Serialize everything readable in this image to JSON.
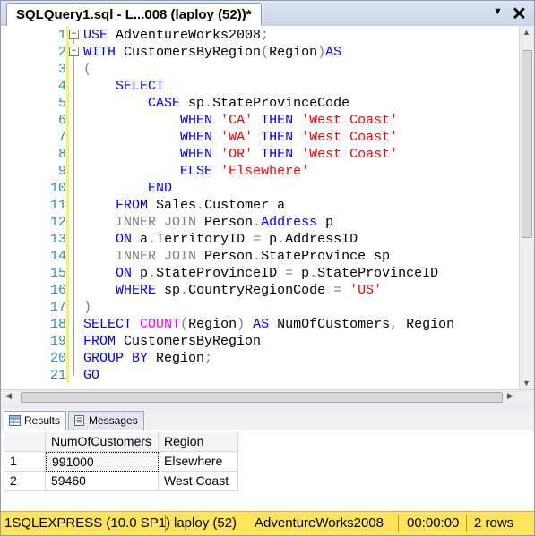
{
  "document_tab": {
    "title": "SQLQuery1.sql - L...008 (laploy (52))*",
    "dropdown_icon": "chevron-down-icon",
    "close_icon": "close-icon"
  },
  "editor": {
    "lines": [
      {
        "num": "1",
        "tokens": [
          {
            "t": "USE",
            "c": "kw"
          },
          {
            "t": " AdventureWorks2008",
            "c": "tx"
          },
          {
            "t": ";",
            "c": "gr"
          }
        ]
      },
      {
        "num": "2",
        "tokens": [
          {
            "t": "WITH",
            "c": "kw"
          },
          {
            "t": " CustomersByRegion",
            "c": "tx"
          },
          {
            "t": "(",
            "c": "gr"
          },
          {
            "t": "Region",
            "c": "tx"
          },
          {
            "t": ")",
            "c": "gr"
          },
          {
            "t": "AS",
            "c": "kw"
          }
        ]
      },
      {
        "num": "3",
        "tokens": [
          {
            "t": "(",
            "c": "gr"
          }
        ]
      },
      {
        "num": "4",
        "tokens": [
          {
            "t": "    ",
            "c": "tx"
          },
          {
            "t": "SELECT",
            "c": "kw"
          }
        ]
      },
      {
        "num": "5",
        "tokens": [
          {
            "t": "        ",
            "c": "tx"
          },
          {
            "t": "CASE",
            "c": "kw"
          },
          {
            "t": " sp",
            "c": "tx"
          },
          {
            "t": ".",
            "c": "gr"
          },
          {
            "t": "StateProvinceCode",
            "c": "tx"
          }
        ]
      },
      {
        "num": "6",
        "tokens": [
          {
            "t": "            ",
            "c": "tx"
          },
          {
            "t": "WHEN",
            "c": "kw"
          },
          {
            "t": " ",
            "c": "tx"
          },
          {
            "t": "'CA'",
            "c": "st"
          },
          {
            "t": " ",
            "c": "tx"
          },
          {
            "t": "THEN",
            "c": "kw"
          },
          {
            "t": " ",
            "c": "tx"
          },
          {
            "t": "'West Coast'",
            "c": "st"
          }
        ]
      },
      {
        "num": "7",
        "tokens": [
          {
            "t": "            ",
            "c": "tx"
          },
          {
            "t": "WHEN",
            "c": "kw"
          },
          {
            "t": " ",
            "c": "tx"
          },
          {
            "t": "'WA'",
            "c": "st"
          },
          {
            "t": " ",
            "c": "tx"
          },
          {
            "t": "THEN",
            "c": "kw"
          },
          {
            "t": " ",
            "c": "tx"
          },
          {
            "t": "'West Coast'",
            "c": "st"
          }
        ]
      },
      {
        "num": "8",
        "tokens": [
          {
            "t": "            ",
            "c": "tx"
          },
          {
            "t": "WHEN",
            "c": "kw"
          },
          {
            "t": " ",
            "c": "tx"
          },
          {
            "t": "'OR'",
            "c": "st"
          },
          {
            "t": " ",
            "c": "tx"
          },
          {
            "t": "THEN",
            "c": "kw"
          },
          {
            "t": " ",
            "c": "tx"
          },
          {
            "t": "'West Coast'",
            "c": "st"
          }
        ]
      },
      {
        "num": "9",
        "tokens": [
          {
            "t": "            ",
            "c": "tx"
          },
          {
            "t": "ELSE",
            "c": "kw"
          },
          {
            "t": " ",
            "c": "tx"
          },
          {
            "t": "'Elsewhere'",
            "c": "st"
          }
        ]
      },
      {
        "num": "10",
        "tokens": [
          {
            "t": "        ",
            "c": "tx"
          },
          {
            "t": "END",
            "c": "kw"
          }
        ]
      },
      {
        "num": "11",
        "tokens": [
          {
            "t": "    ",
            "c": "tx"
          },
          {
            "t": "FROM",
            "c": "kw"
          },
          {
            "t": " Sales",
            "c": "tx"
          },
          {
            "t": ".",
            "c": "gr"
          },
          {
            "t": "Customer a",
            "c": "tx"
          }
        ]
      },
      {
        "num": "12",
        "tokens": [
          {
            "t": "    ",
            "c": "tx"
          },
          {
            "t": "INNER JOIN",
            "c": "gr"
          },
          {
            "t": " Person",
            "c": "tx"
          },
          {
            "t": ".",
            "c": "gr"
          },
          {
            "t": "Address",
            "c": "kw"
          },
          {
            "t": " p",
            "c": "tx"
          }
        ]
      },
      {
        "num": "13",
        "tokens": [
          {
            "t": "    ",
            "c": "tx"
          },
          {
            "t": "ON",
            "c": "kw"
          },
          {
            "t": " a",
            "c": "tx"
          },
          {
            "t": ".",
            "c": "gr"
          },
          {
            "t": "TerritoryID ",
            "c": "tx"
          },
          {
            "t": "=",
            "c": "gr"
          },
          {
            "t": " p",
            "c": "tx"
          },
          {
            "t": ".",
            "c": "gr"
          },
          {
            "t": "AddressID",
            "c": "tx"
          }
        ]
      },
      {
        "num": "14",
        "tokens": [
          {
            "t": "    ",
            "c": "tx"
          },
          {
            "t": "INNER JOIN",
            "c": "gr"
          },
          {
            "t": " Person",
            "c": "tx"
          },
          {
            "t": ".",
            "c": "gr"
          },
          {
            "t": "StateProvince sp",
            "c": "tx"
          }
        ]
      },
      {
        "num": "15",
        "tokens": [
          {
            "t": "    ",
            "c": "tx"
          },
          {
            "t": "ON",
            "c": "kw"
          },
          {
            "t": " p",
            "c": "tx"
          },
          {
            "t": ".",
            "c": "gr"
          },
          {
            "t": "StateProvinceID ",
            "c": "tx"
          },
          {
            "t": "=",
            "c": "gr"
          },
          {
            "t": " p",
            "c": "tx"
          },
          {
            "t": ".",
            "c": "gr"
          },
          {
            "t": "StateProvinceID",
            "c": "tx"
          }
        ]
      },
      {
        "num": "16",
        "tokens": [
          {
            "t": "    ",
            "c": "tx"
          },
          {
            "t": "WHERE",
            "c": "kw"
          },
          {
            "t": " sp",
            "c": "tx"
          },
          {
            "t": ".",
            "c": "gr"
          },
          {
            "t": "CountryRegionCode ",
            "c": "tx"
          },
          {
            "t": "=",
            "c": "gr"
          },
          {
            "t": " ",
            "c": "tx"
          },
          {
            "t": "'US'",
            "c": "st"
          }
        ]
      },
      {
        "num": "17",
        "tokens": [
          {
            "t": ")",
            "c": "gr"
          }
        ]
      },
      {
        "num": "18",
        "tokens": [
          {
            "t": "SELECT",
            "c": "kw"
          },
          {
            "t": " ",
            "c": "tx"
          },
          {
            "t": "COUNT",
            "c": "fn"
          },
          {
            "t": "(",
            "c": "gr"
          },
          {
            "t": "Region",
            "c": "tx"
          },
          {
            "t": ")",
            "c": "gr"
          },
          {
            "t": " ",
            "c": "tx"
          },
          {
            "t": "AS",
            "c": "kw"
          },
          {
            "t": " NumOfCustomers",
            "c": "tx"
          },
          {
            "t": ",",
            "c": "gr"
          },
          {
            "t": " Region",
            "c": "tx"
          }
        ]
      },
      {
        "num": "19",
        "tokens": [
          {
            "t": "FROM",
            "c": "kw"
          },
          {
            "t": " CustomersByRegion",
            "c": "tx"
          }
        ]
      },
      {
        "num": "20",
        "tokens": [
          {
            "t": "GROUP BY",
            "c": "kw"
          },
          {
            "t": " Region",
            "c": "tx"
          },
          {
            "t": ";",
            "c": "gr"
          }
        ]
      },
      {
        "num": "21",
        "tokens": [
          {
            "t": "GO",
            "c": "kw"
          }
        ]
      }
    ],
    "fold_markers": [
      "−",
      "−"
    ]
  },
  "results_tabs": [
    {
      "label": "Results",
      "icon": "results-grid-icon",
      "active": true
    },
    {
      "label": "Messages",
      "icon": "messages-icon",
      "active": false
    }
  ],
  "results_grid": {
    "columns": [
      "NumOfCustomers",
      "Region"
    ],
    "rows": [
      {
        "row_num": "1",
        "cells": [
          "991000",
          "Elsewhere"
        ]
      },
      {
        "row_num": "2",
        "cells": [
          "59460",
          "West Coast"
        ]
      }
    ]
  },
  "status_bar": {
    "segments": [
      "1SQLEXPRESS (10.0 SP1)",
      "laploy (52)",
      "AdventureWorks2008",
      "00:00:00",
      "2 rows"
    ],
    "background": "#ffe45c"
  },
  "colors": {
    "keyword": "#0000ff",
    "operator": "#808080",
    "string": "#ff0000",
    "function": "#ff00ff",
    "line_number": "#2b91af"
  }
}
